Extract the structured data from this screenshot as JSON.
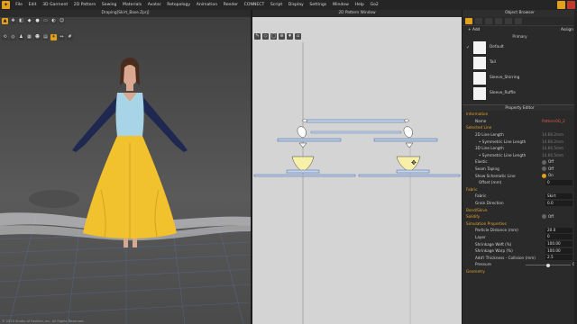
{
  "menu": {
    "items": [
      "File",
      "Edit",
      "3D Garment",
      "2D Pattern",
      "Sewing",
      "Materials",
      "Avatar",
      "Retopology",
      "Animation",
      "Render",
      "CONNECT",
      "Script",
      "Display",
      "Settings",
      "Window",
      "Help",
      "Go2"
    ]
  },
  "panel3d": {
    "title": "Draping[Skirt_Base.Zprj]"
  },
  "panel2d": {
    "title": "2D Pattern Window"
  },
  "object_browser": {
    "title": "Object Browser",
    "add_label": "+ Add",
    "assign_label": "Assign",
    "primary_label": "Primary",
    "swatches": [
      "Default",
      "Tail",
      "Sleeve_Shirring",
      "Sleeve_Ruffle"
    ]
  },
  "property_editor": {
    "title": "Property Editor",
    "information": "Information",
    "name_label": "Name",
    "name_value": "Pattern0G_2",
    "selected_line": "Selected Line",
    "line_rows": [
      {
        "k": "2D Line Length",
        "v": "14.66.2mm"
      },
      {
        "k": "• Symmetric Line Length",
        "v": "14.66.2mm"
      },
      {
        "k": "3D Line Length",
        "v": "14.66.5mm"
      },
      {
        "k": "• Symmetric Line Length",
        "v": "14.66.5mm"
      }
    ],
    "elastic": {
      "k": "Elastic",
      "v": "Off"
    },
    "seam_taping": {
      "k": "Seam Taping",
      "v": "Off"
    },
    "schematic": {
      "k": "Show Schematic Line",
      "v": "On"
    },
    "offset": {
      "k": "Offset (mm)",
      "v": "0"
    },
    "fabric_section": "Fabric",
    "fabric": {
      "k": "Fabric",
      "v": "Skirt"
    },
    "grain": {
      "k": "Grain Direction",
      "v": "0.0"
    },
    "bond": "Bond/Skive",
    "solidify": {
      "k": "Solidify",
      "v": "Off"
    },
    "sim_section": "Simulation Properties",
    "sim_rows": [
      {
        "k": "Particle Distance (mm)",
        "v": "20.0"
      },
      {
        "k": "Layer",
        "v": "0"
      },
      {
        "k": "Shrinkage Weft (%)",
        "v": "100.00"
      },
      {
        "k": "Shrinkage Warp (%)",
        "v": "100.00"
      },
      {
        "k": "Add'l Thickness - Collision (mm)",
        "v": "2.5"
      }
    ],
    "pressure": {
      "k": "Pressure",
      "v": "0"
    },
    "geometry": "Geometry"
  },
  "status": "© 2023 Studio of Fashion, inc. All Rights Reserved.",
  "colors": {
    "accent": "#e2a01c",
    "bodice": "#a8d4e8",
    "skirt": "#f2c12e",
    "sleeve": "#1e2850"
  }
}
